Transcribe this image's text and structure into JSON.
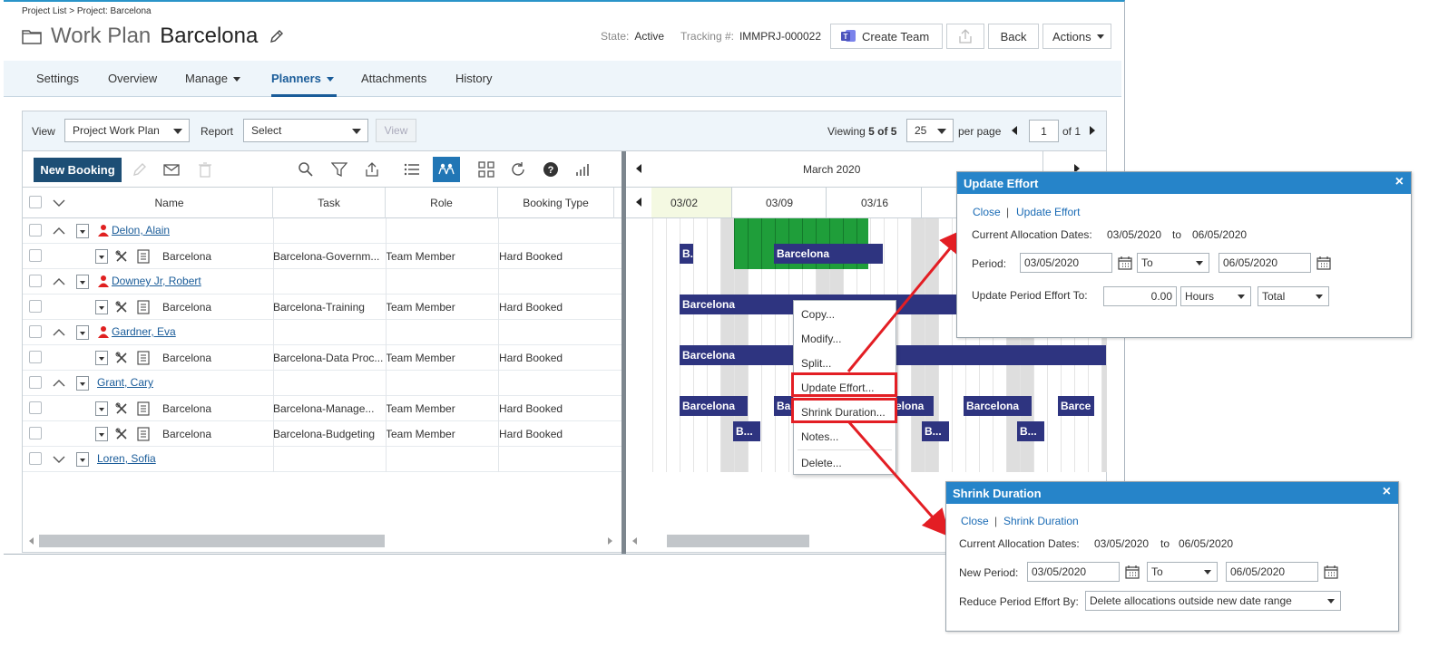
{
  "header": {
    "breadcrumb": "Project List > Project: Barcelona",
    "title_prefix": "Work Plan",
    "title_name": "Barcelona",
    "state_label": "State:",
    "state_value": "Active",
    "tracking_label": "Tracking #:",
    "tracking_value": "IMMPRJ-000022",
    "create_team_label": "Create Team",
    "back_label": "Back",
    "actions_label": "Actions"
  },
  "nav": {
    "settings": "Settings",
    "overview": "Overview",
    "manage": "Manage",
    "planners": "Planners",
    "attachments": "Attachments",
    "history": "History"
  },
  "filter": {
    "view_label": "View",
    "view_value": "Project Work Plan",
    "report_label": "Report",
    "report_value": "Select",
    "view_button": "View",
    "viewing_prefix": "Viewing ",
    "viewing_count": "5 of 5",
    "per_page_value": "25",
    "per_page_label": "per page",
    "page_value": "1",
    "page_of": "of 1"
  },
  "toolbar": {
    "new_booking": "New Booking"
  },
  "grid": {
    "columns": [
      "Name",
      "Task",
      "Role",
      "Booking Type"
    ],
    "rows": [
      {
        "name": "Delon, Alain",
        "task": "",
        "role": "",
        "type": ""
      },
      {
        "name": "Barcelona",
        "task": "Barcelona-Governm...",
        "role": "Team Member",
        "type": "Hard Booked"
      },
      {
        "name": "Downey Jr, Robert",
        "task": "",
        "role": "",
        "type": ""
      },
      {
        "name": "Barcelona",
        "task": "Barcelona-Training",
        "role": "Team Member",
        "type": "Hard Booked"
      },
      {
        "name": "Gardner, Eva",
        "task": "",
        "role": "",
        "type": ""
      },
      {
        "name": "Barcelona",
        "task": "Barcelona-Data Proc...",
        "role": "Team Member",
        "type": "Hard Booked"
      },
      {
        "name": "Grant, Cary",
        "task": "",
        "role": "",
        "type": ""
      },
      {
        "name": "Barcelona",
        "task": "Barcelona-Manage...",
        "role": "Team Member",
        "type": "Hard Booked"
      },
      {
        "name": "Barcelona",
        "task": "Barcelona-Budgeting",
        "role": "Team Member",
        "type": "Hard Booked"
      },
      {
        "name": "Loren, Sofia",
        "task": "",
        "role": "",
        "type": ""
      }
    ]
  },
  "gantt": {
    "month": "March 2020",
    "weeks": [
      "03/02",
      "03/09",
      "03/16"
    ],
    "bar_label": "Barcelona",
    "bar_short_1": "B.",
    "bar_short_2": "B...",
    "bar_partial_1": "Bar",
    "bar_partial_2": "elona",
    "bar_partial_3": "Barce",
    "bar_color": "#2e3480",
    "highlight_color": "#1f9e3a"
  },
  "context_menu": {
    "items": [
      "Copy...",
      "Modify...",
      "Split...",
      "Update Effort...",
      "Shrink Duration...",
      "Notes...",
      "Delete..."
    ]
  },
  "update_effort_dialog": {
    "title": "Update Effort",
    "close": "Close",
    "action": "Update Effort",
    "current_label": "Current Allocation Dates:",
    "current_from": "03/05/2020",
    "current_to_word": "to",
    "current_to": "06/05/2020",
    "period_label": "Period:",
    "period_from": "03/05/2020",
    "period_mode": "To",
    "period_to": "06/05/2020",
    "effort_label": "Update Period Effort To:",
    "effort_value": "0.00",
    "unit": "Hours",
    "scope": "Total"
  },
  "shrink_dialog": {
    "title": "Shrink Duration",
    "close": "Close",
    "action": "Shrink Duration",
    "current_label": "Current Allocation Dates:",
    "current_from": "03/05/2020",
    "current_to_word": "to",
    "current_to": "06/05/2020",
    "new_period_label": "New Period:",
    "period_from": "03/05/2020",
    "period_mode": "To",
    "period_to": "06/05/2020",
    "reduce_label": "Reduce Period Effort By:",
    "reduce_value": "Delete allocations outside new date range"
  }
}
